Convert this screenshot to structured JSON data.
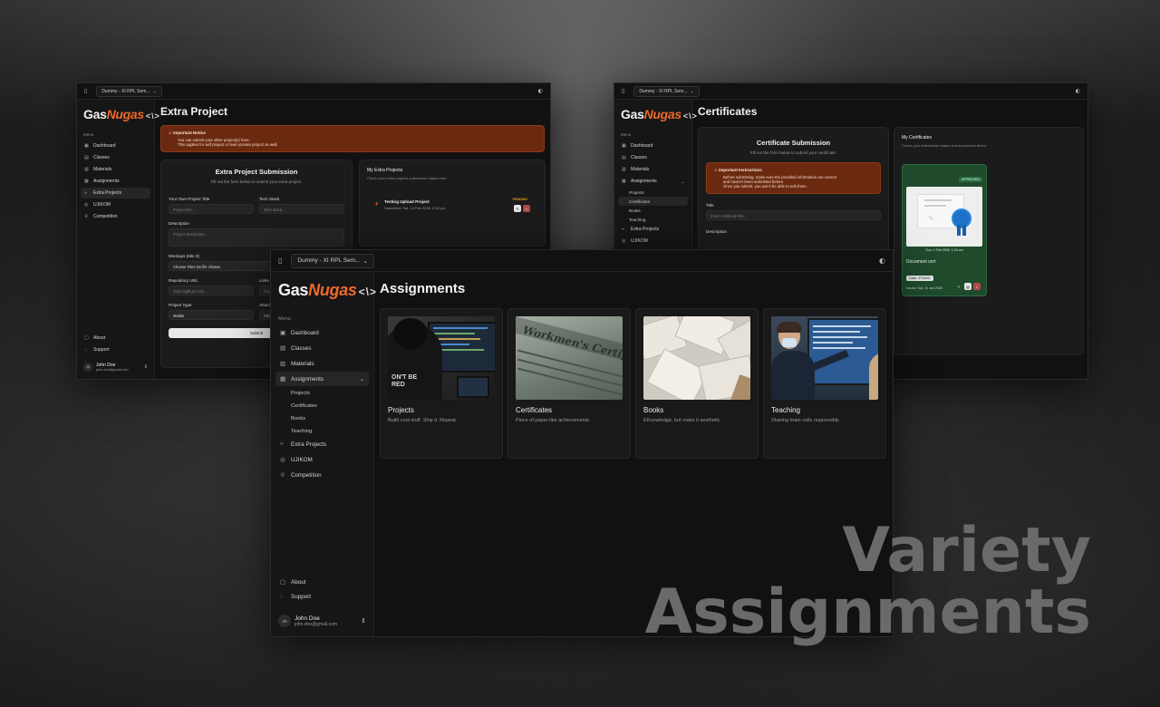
{
  "workspace": "Dummy - XI RPL Sem...",
  "brand": {
    "gas": "Gas",
    "nugas": "Nugas",
    "bracket": "<\\>"
  },
  "menu_label": "Menu",
  "nav": {
    "dashboard": "Dashboard",
    "classes": "Classes",
    "materials": "Materials",
    "assignments": "Assignments",
    "projects": "Projects",
    "certificates": "Certificates",
    "books": "Books",
    "teaching": "Teaching",
    "extra_projects": "Extra Projects",
    "ujikom": "UJIKOM",
    "competition": "Competition",
    "about": "About",
    "support": "Support"
  },
  "user": {
    "initials": "JD",
    "name": "John Doe",
    "email": "john.doe@gmail.com"
  },
  "extra": {
    "title": "Extra Project",
    "notice_title": "Important Notice",
    "notice_line1": "You can submit your other project(s) here.",
    "notice_line2": "This applies for self project or team private project as well.",
    "form_title": "Extra Project Submission",
    "form_sub": "Fill out the form below to submit your extra project.",
    "label_title": "Your Own Project Title",
    "ph_title": "Project title...",
    "label_stack": "Tech Stack",
    "ph_stack": "Tech stack...",
    "label_desc": "Description",
    "ph_desc": "Project description...",
    "label_mockups": "Mockups (Min 3)",
    "file_btn": "Choose Files",
    "file_none": "No file chosen",
    "label_repo": "Repository URL",
    "ph_repo": "https://github.com/...",
    "label_linked": "Linke",
    "ph_linked": "http",
    "label_type": "Project Type",
    "type_value": "Mobile",
    "label_attach": "Attach",
    "attach_value": "Cho",
    "submit": "Submit",
    "list_title": "My Extra Projects",
    "list_sub": "Check your extra projects submission status here.",
    "item_title": "Testing Upload Project",
    "item_date": "Submitted: Sat, 14 Feb 2026, 6:52 pm",
    "item_status": "PENDING"
  },
  "cert": {
    "title": "Certificates",
    "form_title": "Certificate Submission",
    "form_sub": "Fill out the form below to submit your certificate.",
    "notice_title": "Important Instructions",
    "notice_line1": "Before submitting, make sure the provided information are correct",
    "notice_line2": "and haven't been submitted before.",
    "notice_line3": "Once you submit, you won't be able to edit them.",
    "label_title": "Title",
    "ph_title": "Enter certificate title...",
    "label_desc": "Description",
    "list_title": "My Certificates",
    "list_sub": "Check your submission status and documents below.",
    "badge": "APPROVED",
    "item_date": "Sun, 1 Feb 2026, 1:20 am",
    "item_name": "Document cert",
    "item_chip": "Case: 4TNA0N",
    "item_issued": "Issued: Sat, 31 Jan 2026"
  },
  "assignments": {
    "title": "Assignments",
    "cards": [
      {
        "title": "Projects",
        "desc": "Build cool stuff. Ship it. Repeat."
      },
      {
        "title": "Certificates",
        "desc": "Piece of paper-like achievements."
      },
      {
        "title": "Books",
        "desc": "EKnowledge, but make it aesthetic."
      },
      {
        "title": "Teaching",
        "desc": "Sharing brain cells responsibly."
      }
    ],
    "shirt_text": "ON'T BE RED",
    "cert_text": "Workmen's Certificate"
  },
  "headline": {
    "line1": "Variety",
    "line2": "Assignments"
  },
  "colors": {
    "accent": "#ef6a2a",
    "notice_bg": "#6b2a10",
    "approved_bg": "#1f4a2c",
    "pending": "#e0a020",
    "delete": "#b34848"
  }
}
